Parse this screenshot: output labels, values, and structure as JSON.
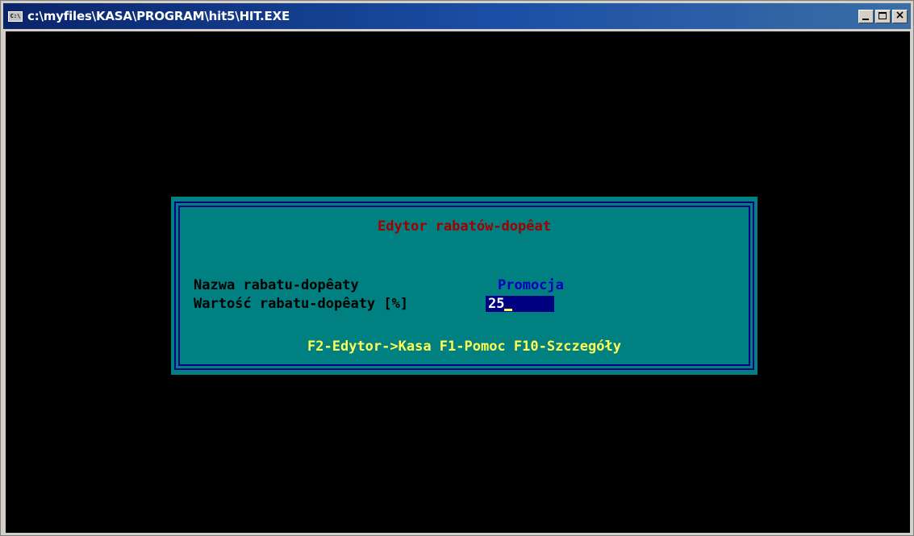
{
  "window": {
    "title": "c:\\myfiles\\KASA\\PROGRAM\\hit5\\HIT.EXE",
    "icon": "console-icon",
    "icon_text": "C:\\",
    "buttons": [
      "minimize",
      "maximize",
      "close"
    ]
  },
  "dialog": {
    "title": "Edytor rabatów-dopêat",
    "fields": [
      {
        "label": "Nazwa rabatu-dopêaty",
        "value": "Promocja"
      },
      {
        "label": "Wartość rabatu-dopêaty [%]",
        "value": "25"
      }
    ],
    "hotkeys": "F2-Edytor->Kasa F1-Pomoc F10-Szczegóły"
  },
  "colors": {
    "console_bg": "#000000",
    "dialog_bg": "#008080",
    "frame": "#000080",
    "title_text": "#a00000",
    "value_text": "#0000c0",
    "input_bg": "#000080",
    "hotkeys_text": "#ffff55"
  }
}
